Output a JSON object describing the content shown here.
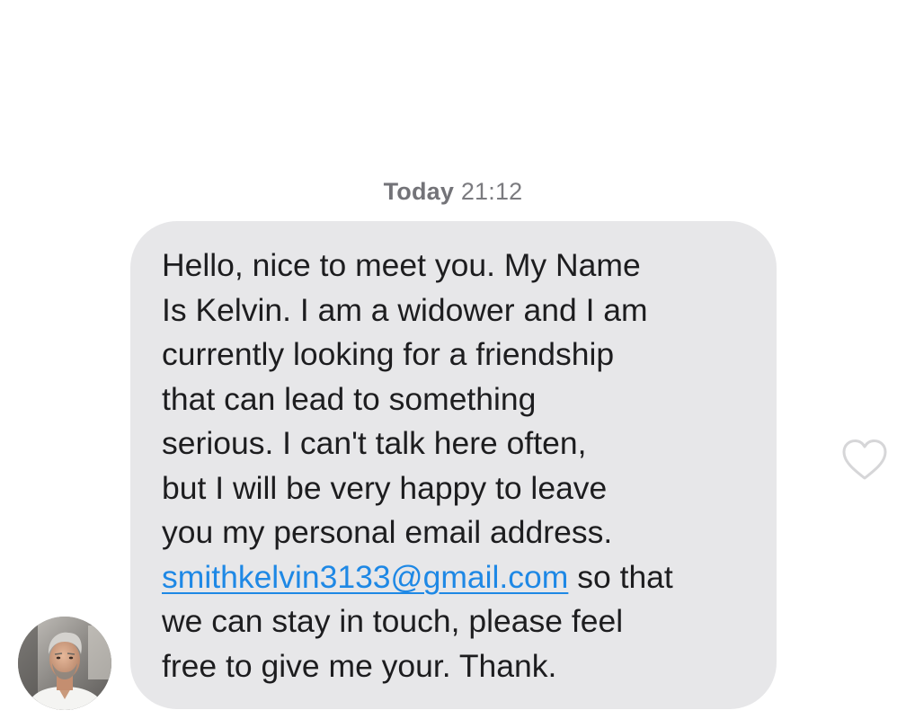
{
  "conversation": {
    "timestamp": {
      "day": "Today",
      "time": "21:12"
    },
    "message": {
      "text_before": "Hello, nice to meet you. My Name\nIs Kelvin. I am a widower and I am\ncurrently looking for a friendship\nthat can lead to something\nserious. I can't talk here often,\nbut I will be very happy to leave\nyou my personal email address.\n",
      "email": "smithkelvin3133@gmail.com",
      "text_after": " so that\nwe can stay in touch, please feel\nfree to give me your. Thank."
    },
    "like_icon": "heart-outline-icon",
    "sender_avatar": "avatar-photo"
  },
  "colors": {
    "bubble_background": "#e7e7e9",
    "message_text": "#1d1d1f",
    "link": "#1e88e5",
    "timestamp": "#7b7b7f",
    "heart_outline": "#d6d6d8"
  }
}
